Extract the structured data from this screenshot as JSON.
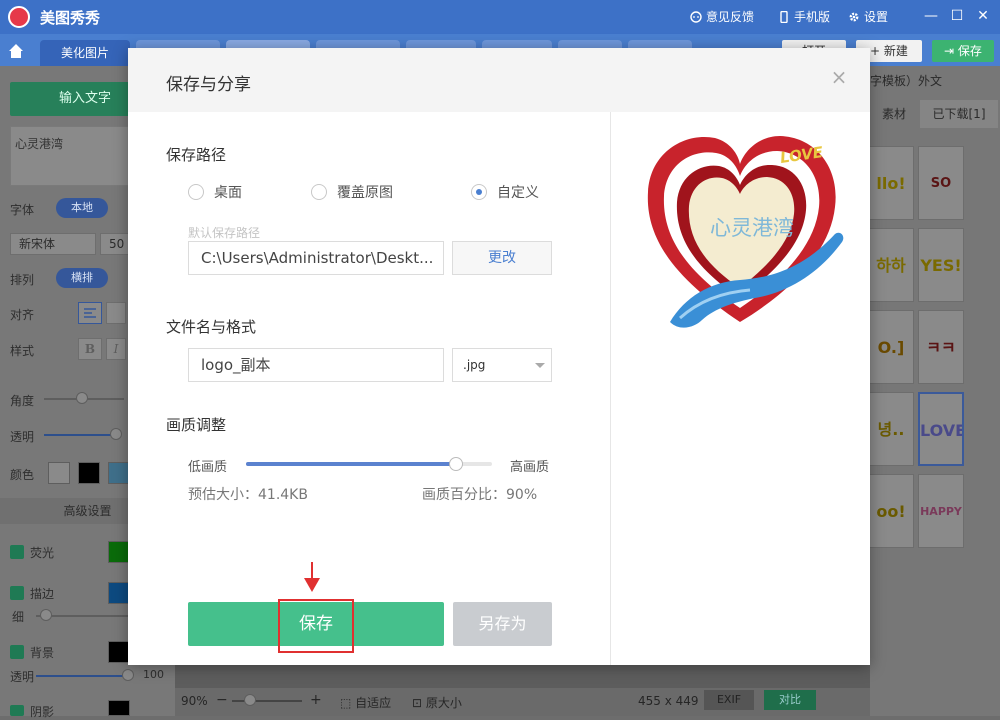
{
  "app": {
    "title": "美图秀秀",
    "feedback": "意见反馈",
    "mobile": "手机版",
    "settings": "设置"
  },
  "tabs": [
    {
      "label": "美化图片"
    },
    {
      "label": ""
    },
    {
      "label": ""
    },
    {
      "label": ""
    },
    {
      "label": ""
    },
    {
      "label": ""
    },
    {
      "label": ""
    },
    {
      "label": ""
    }
  ],
  "top_actions": {
    "open": "打开",
    "new": "新建",
    "save": "保存"
  },
  "left_panel": {
    "input_text_button": "输入文字",
    "text_value": "心灵港湾",
    "font_label": "字体",
    "font_source": "本地",
    "font_name": "新宋体",
    "font_size": "50",
    "layout_label": "排列",
    "layout_value": "横排",
    "align_label": "对齐",
    "style_label": "样式",
    "bold_glyph": "B",
    "italic_glyph": "I",
    "angle_label": "角度",
    "opacity_label": "透明",
    "color_label": "颜色",
    "advanced_label": "高级设置",
    "glow_label": "荧光",
    "stroke_label": "描边",
    "thin_label": "细",
    "background_label": "背景",
    "bg_opacity_label": "透明",
    "bg_opacity_value": "100",
    "shadow_label": "阴影"
  },
  "right_panel": {
    "header": "字模板）外文",
    "tab_material": "素材",
    "tab_downloaded": "已下载[1]",
    "thumbs": [
      "llo!",
      "SO HOT",
      "하하",
      "YES!",
      "O.]",
      "ㅋㅋㅋ",
      "녕..",
      "LOVE",
      "oo!",
      "HAPPY"
    ]
  },
  "bottom_bar": {
    "zoom": "90%",
    "fit": "自适应",
    "original": "原大小",
    "dimensions": "455 x 449",
    "exif": "EXIF",
    "compare": "对比"
  },
  "dialog": {
    "title": "保存与分享",
    "close_glyph": "×",
    "save_path_title": "保存路径",
    "options": [
      "桌面",
      "覆盖原图",
      "自定义"
    ],
    "selected_option": "自定义",
    "default_path_hint": "默认保存路径",
    "path_value": "C:\\Users\\Administrator\\Deskt...",
    "change_button": "更改",
    "filename_title": "文件名与格式",
    "filename_value": "logo_副本",
    "format_value": ".jpg",
    "quality_title": "画质调整",
    "quality_low": "低画质",
    "quality_high": "高画质",
    "quality_percent": 90,
    "estimated_size": "预估大小：41.4KB",
    "quality_ratio": "画质百分比：90%",
    "save_button": "保存",
    "save_as_button": "另存为"
  },
  "preview": {
    "logo_text": "心灵港湾",
    "love_text": "LOVE"
  },
  "colors": {
    "accent_blue": "#4a7fd0",
    "save_green": "#45c08c",
    "highlight_red": "#e03030",
    "heart_red": "#c8232c",
    "hand_blue": "#3a8fd6"
  }
}
